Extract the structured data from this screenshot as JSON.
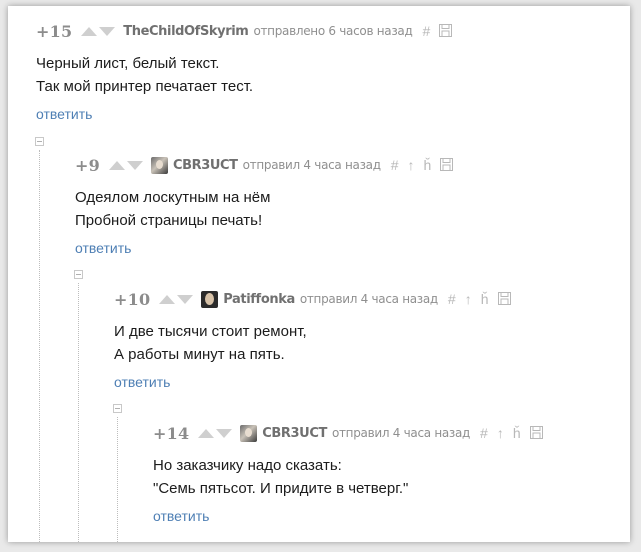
{
  "comments": [
    {
      "score": "+15",
      "user": "TheChildOfSkyrim",
      "meta": "отправлено 6 часов назад",
      "lines": [
        "Черный лист, белый текст.",
        "Так мой принтер печатает тест."
      ],
      "reply": "ответить"
    },
    {
      "score": "+9",
      "user": "CBR3UCT",
      "meta": "отправил 4 часа назад",
      "lines": [
        "Одеялом лоскутным на нём",
        "Пробной страницы печать!"
      ],
      "reply": "ответить"
    },
    {
      "score": "+10",
      "user": "Patiffonka",
      "meta": "отправил 4 часа назад",
      "lines": [
        "И две тысячи стоит ремонт,",
        "А работы минут на пять."
      ],
      "reply": "ответить"
    },
    {
      "score": "+14",
      "user": "CBR3UCT",
      "meta": "отправил 4 часа назад",
      "lines": [
        "Но заказчику надо сказать:",
        "\"Семь пятьсот. И придите в четверг.\""
      ],
      "reply": "ответить"
    }
  ],
  "icons": {
    "permalink": "#",
    "parent": "↑",
    "branch": "ȟ",
    "save": "floppy-disk-icon",
    "collapse": "collapse-minus-icon",
    "vote_up": "vote-up-icon",
    "vote_down": "vote-down-icon"
  },
  "colors": {
    "score": "#8c8c8c",
    "username": "#707070",
    "meta": "#8f8f8f",
    "reply_link": "#4e7fb4",
    "text": "#1c1c1c",
    "vote_arrows": "#cfcfcf"
  }
}
